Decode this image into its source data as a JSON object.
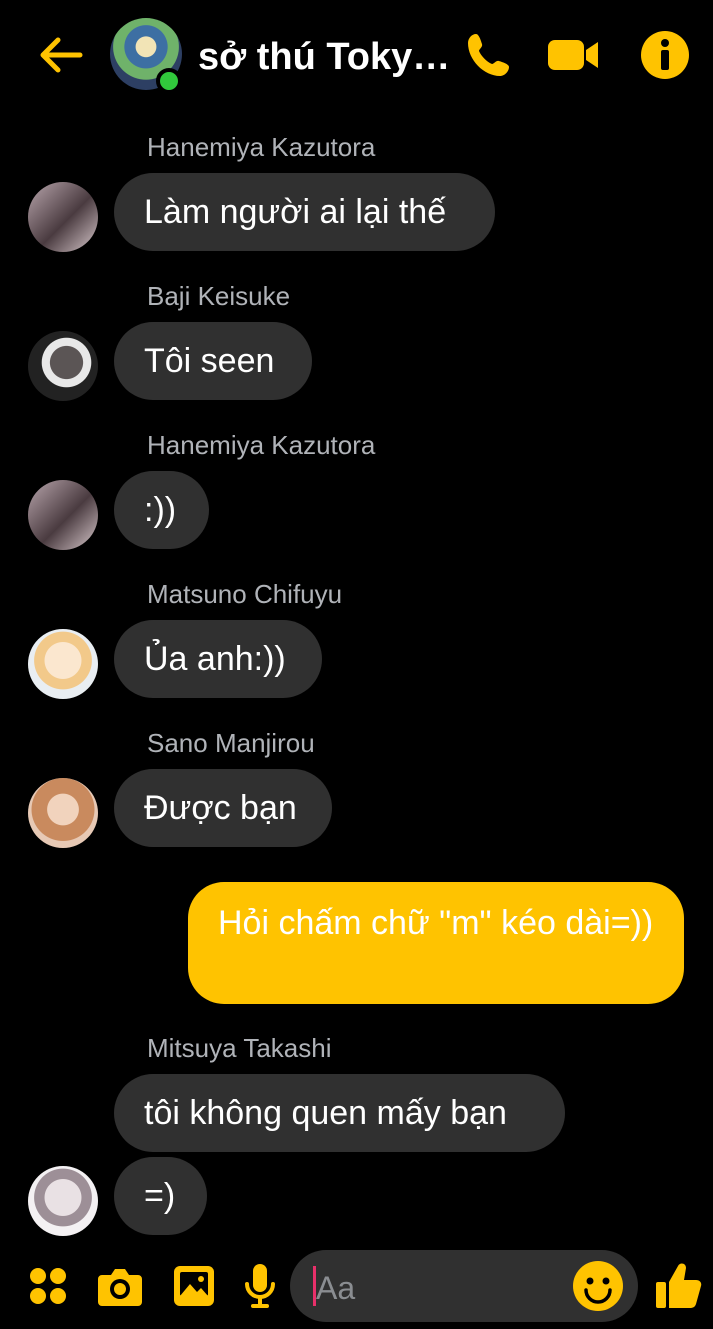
{
  "header": {
    "back_icon": "arrow-left-icon",
    "group_name": "sở thú Tokyo...",
    "online": true,
    "icons": [
      "phone-icon",
      "video-camera-icon",
      "info-icon"
    ],
    "accent_color": "#ffc300"
  },
  "messages": [
    {
      "sender": "Hanemiya Kazutora",
      "text": "Làm người ai lại thế"
    },
    {
      "sender": "Baji Keisuke",
      "text": "Tôi seen"
    },
    {
      "sender": "Hanemiya Kazutora",
      "text": ":))"
    },
    {
      "sender": "Matsuno Chifuyu",
      "text": "Ủa anh:))"
    },
    {
      "sender": "Sano Manjirou",
      "text": "Được bạn"
    },
    {
      "sender": "me",
      "text": "Hỏi chấm chữ \"m\" kéo dài=))"
    },
    {
      "sender": "Mitsuya Takashi",
      "text": "tôi không quen mấy bạn"
    },
    {
      "sender": "Mitsuya Takashi",
      "text": "=)"
    }
  ],
  "composer": {
    "placeholder": "Aa",
    "icons": [
      "apps-grid-icon",
      "camera-icon",
      "gallery-icon",
      "microphone-icon",
      "emoji-icon",
      "thumbs-up-icon"
    ]
  }
}
